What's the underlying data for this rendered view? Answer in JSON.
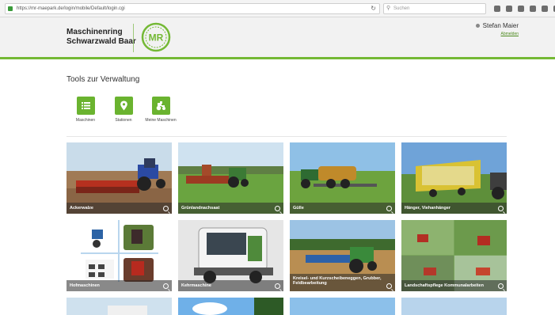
{
  "browser": {
    "url": "https://mr-maepark.de/login/mobile/Default/login.cgi",
    "search_placeholder": "Suchen",
    "icons": [
      "star-icon",
      "bookmarks-icon",
      "pocket-icon",
      "download-icon",
      "profile-icon",
      "home-icon"
    ]
  },
  "header": {
    "brand_line1": "Maschinenring",
    "brand_line2": "Schwarzwald Baar",
    "logo_text": "MR",
    "user_name": "Stefan Maier",
    "logout_label": "Abmelden",
    "accent_color": "#74b935"
  },
  "tools": {
    "title": "Tools zur Verwaltung",
    "items": [
      {
        "label": "Maschinen",
        "icon": "list-icon"
      },
      {
        "label": "Stationen",
        "icon": "map-pin-icon"
      },
      {
        "label": "Meine Maschinen",
        "icon": "tractor-icon"
      }
    ]
  },
  "cards": [
    {
      "label": "Ackerwalze"
    },
    {
      "label": "Grünlandnachsaat"
    },
    {
      "label": "Gülle"
    },
    {
      "label": "Hänger, Viehanhänger"
    },
    {
      "label": "Hofmaschinen"
    },
    {
      "label": "Kehrmaschine"
    },
    {
      "label": "Kreisel- und Kurzscheibeneggen, Grubber, Feldbearbeitung"
    },
    {
      "label": "Landschaftspflege Kommunalarbeiten"
    }
  ]
}
